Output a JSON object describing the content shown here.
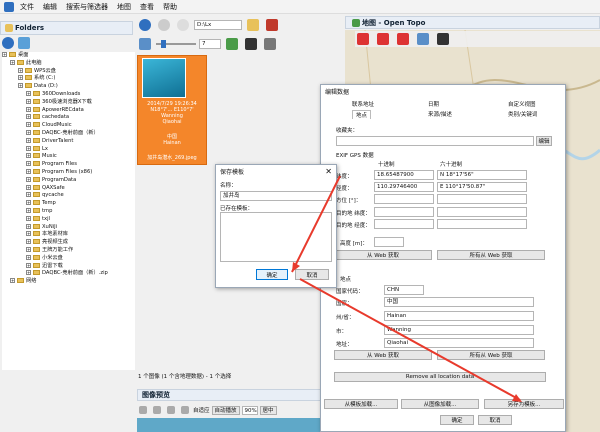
{
  "menu": {
    "items": [
      "文件",
      "编辑",
      "搜索与筛选器",
      "地图",
      "查看",
      "帮助"
    ]
  },
  "folders_panel": {
    "title": "Folders"
  },
  "tree": [
    {
      "label": "桌面",
      "level": 0
    },
    {
      "label": "此电脑",
      "level": 1
    },
    {
      "label": "WPS云盘",
      "level": 2
    },
    {
      "label": "系统 (C:)",
      "level": 2
    },
    {
      "label": "Data (D:)",
      "level": 2
    },
    {
      "label": "360Downloads",
      "level": 3
    },
    {
      "label": "360极速浏览器X下载",
      "level": 3
    },
    {
      "label": "ApowerRECdata",
      "level": 3
    },
    {
      "label": "cachedata",
      "level": 3
    },
    {
      "label": "CloudMusic",
      "level": 3
    },
    {
      "label": "DAQBC-竞射前面（新）",
      "level": 3
    },
    {
      "label": "DriverTalent",
      "level": 3
    },
    {
      "label": "Lx",
      "level": 3
    },
    {
      "label": "Music",
      "level": 3
    },
    {
      "label": "Program Files",
      "level": 3
    },
    {
      "label": "Program Files (x86)",
      "level": 3
    },
    {
      "label": "ProgramData",
      "level": 3
    },
    {
      "label": "QAXSafe",
      "level": 3
    },
    {
      "label": "qycache",
      "level": 3
    },
    {
      "label": "Temp",
      "level": 3
    },
    {
      "label": "tmp",
      "level": 3
    },
    {
      "label": "txjl",
      "level": 3
    },
    {
      "label": "XuNiJi",
      "level": 3
    },
    {
      "label": "本地素材库",
      "level": 3
    },
    {
      "label": "亮视频生成",
      "level": 3
    },
    {
      "label": "王牌万能工作",
      "level": 3
    },
    {
      "label": "小米云盘",
      "level": 3
    },
    {
      "label": "迅雷下载",
      "level": 3
    },
    {
      "label": "DAQBC-竞射前面（新）.zip",
      "level": 3
    },
    {
      "label": "网络",
      "level": 1
    }
  ],
  "browser": {
    "path": "D:\\Lx",
    "zoom": "7"
  },
  "thumbnail": {
    "date": "2014/7/29 19:26:34",
    "coords": "N18°7'... E110°7'",
    "place1": "Wanning",
    "place2": "Qiaohai",
    "country": "中国",
    "province": "Hainan",
    "filename": "加井岛潜水_269.jpeg"
  },
  "status": {
    "text": "1 个图像 (1 个含地理数据) - 1 个选择"
  },
  "preview": {
    "title": "图像预览",
    "fit_label": "自适应",
    "autoplay_label": "自动播放",
    "percent": "90%",
    "center": "居中"
  },
  "map_panel": {
    "title": "地图 - Open Topo"
  },
  "edit_dialog": {
    "title": "编辑数据",
    "tabs_row1": [
      "联系地址",
      "日期",
      "自定义视图"
    ],
    "tabs_row2": [
      "地点",
      "来源/描述",
      "类别/关键词"
    ],
    "favorites_label": "收藏夹：",
    "edit_button": "编辑",
    "exif_label": "EXIF GPS 数据",
    "decimal_header": "十进制",
    "sexagesimal_header": "六十进制",
    "lat_label": "纬度：",
    "lon_label": "经度：",
    "dir_label": "方位 [°]：",
    "dest_lat_label": "目的地 纬度：",
    "dest_lon_label": "目的地 经度：",
    "alt_label": "高度 [m]：",
    "lat_decimal": "18.65487900",
    "lat_sexa": "N 18°17'56\"",
    "lon_decimal": "110.29746400",
    "lon_sexa": "E 110°17'50.87\"",
    "from_web_button": "从 Web 获取",
    "all_from_web_button": "所有从 Web 获取",
    "address_group_label": "地点",
    "country_code_label": "国家代码：",
    "country_code_value": "CHN",
    "country_label": "国家：",
    "country_value": "中国",
    "province_label": "州/省：",
    "province_value": "Hainan",
    "city_label": "市：",
    "city_value": "Wanning",
    "address_label": "地址：",
    "address_value": "Qiaohai",
    "from_web_button2": "从 Web 获取",
    "all_from_web_button2": "所有从 Web 获取",
    "remove_button": "Remove all location data",
    "load_template_button": "从模板加载...",
    "load_image_button": "从图像加载...",
    "save_template_button": "另存为模板...",
    "ok_button": "确定",
    "cancel_button": "取消"
  },
  "save_dialog": {
    "title": "保存模板",
    "name_label": "名称：",
    "name_value": "加井岛",
    "existing_label": "已存在模板：",
    "ok_button": "确定",
    "cancel_button": "取消"
  },
  "colors": {
    "accent": "#2f6fbf",
    "thumb_bg": "#f4862a",
    "arrow": "#e83a2c"
  }
}
